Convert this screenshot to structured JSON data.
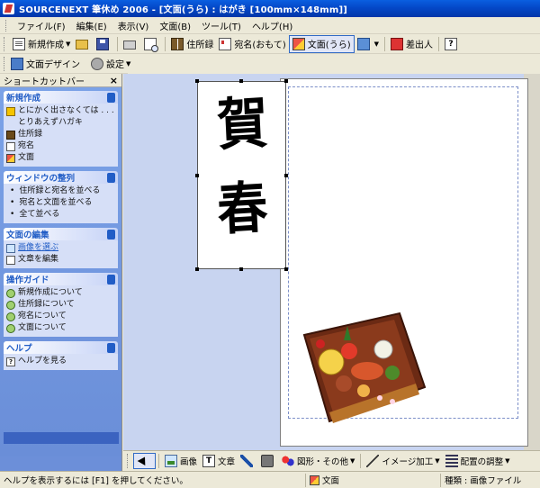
{
  "window": {
    "title": "SOURCENEXT 筆休め 2006 - [文面(うら) : はがき [100mm×148mm]]"
  },
  "menubar": {
    "items": [
      "ファイル(F)",
      "編集(E)",
      "表示(V)",
      "文面(B)",
      "ツール(T)",
      "ヘルプ(H)"
    ]
  },
  "toolbar": {
    "new_label": "新規作成",
    "address_book_label": "住所録",
    "address_front_label": "宛名(おもて)",
    "back_label": "文面(うら)",
    "sender_label": "差出人"
  },
  "toolbar2": {
    "design_label": "文面デザイン",
    "settings_label": "設定"
  },
  "sidebar": {
    "title": "ショートカットバー",
    "close": "×",
    "panels": [
      {
        "heading": "新規作成",
        "items": [
          {
            "label": "とにかく出さなくては . . .",
            "icon": "star-icon"
          },
          {
            "label": "とりあえずハガキ",
            "icon": ""
          },
          {
            "label": "住所録",
            "icon": "address-book-icon"
          },
          {
            "label": "宛名",
            "icon": "address-card-icon"
          },
          {
            "label": "文面",
            "icon": "message-icon"
          }
        ]
      },
      {
        "heading": "ウィンドウの整列",
        "items": [
          {
            "label": "住所録と宛名を並べる"
          },
          {
            "label": "宛名と文面を並べる"
          },
          {
            "label": "全て並べる"
          }
        ]
      },
      {
        "heading": "文面の編集",
        "items": [
          {
            "label": "画像を選ぶ",
            "icon": "image-icon"
          },
          {
            "label": "文章を編集",
            "icon": "text-edit-icon"
          }
        ]
      },
      {
        "heading": "操作ガイド",
        "items": [
          {
            "label": "新規作成について"
          },
          {
            "label": "住所録について"
          },
          {
            "label": "宛名について"
          },
          {
            "label": "文面について"
          }
        ]
      },
      {
        "heading": "ヘルプ",
        "items": [
          {
            "label": "ヘルプを見る",
            "icon": "help-icon"
          }
        ]
      }
    ]
  },
  "canvas": {
    "calligraphy_line1": "賀",
    "calligraphy_line2": "春"
  },
  "bottom_toolbar": {
    "image_label": "画像",
    "text_label": "文章",
    "shapes_label": "図形・その他",
    "image_effect_label": "イメージ加工",
    "align_label": "配置の調整"
  },
  "statusbar": {
    "hint": "ヘルプを表示するには [F1] を押してください。",
    "mode": "文面",
    "kind": "種類 : 画像ファイル"
  }
}
